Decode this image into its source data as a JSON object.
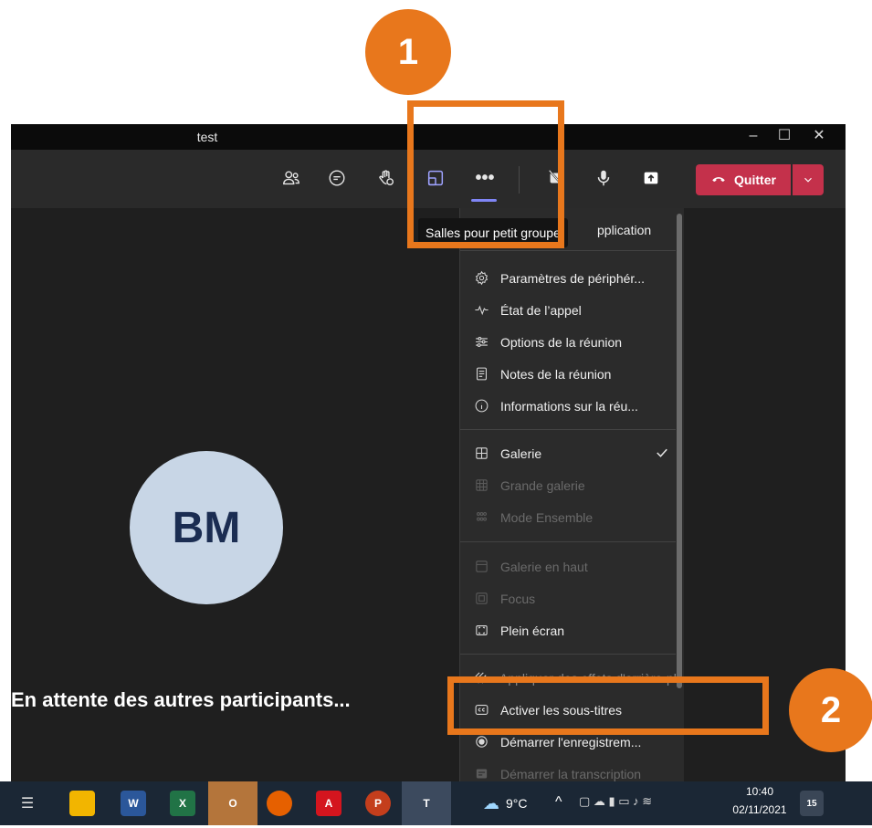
{
  "window": {
    "title": "test",
    "controls": {
      "minimize": "–",
      "maximize": "☐",
      "close": "✕"
    }
  },
  "toolbar": {
    "icons": [
      "participants-icon",
      "chat-icon",
      "raise-hand-icon",
      "breakout-rooms-icon",
      "more-actions-icon",
      "camera-off-icon",
      "mic-icon",
      "share-icon"
    ],
    "quit_label": "Quitter"
  },
  "tooltip": "Salles pour petit groupe",
  "menu": {
    "partial_top_item": "pplication",
    "items": [
      {
        "label": "Paramètres de périphér...",
        "icon": "gear-icon",
        "disabled": false
      },
      {
        "label": "État de l’appel",
        "icon": "pulse-icon",
        "disabled": false
      },
      {
        "label": "Options de la réunion",
        "icon": "sliders-icon",
        "disabled": false
      },
      {
        "label": "Notes de la réunion",
        "icon": "notes-icon",
        "disabled": false
      },
      {
        "label": "Informations sur la réu...",
        "icon": "info-icon",
        "disabled": false
      },
      {
        "label": "Galerie",
        "icon": "grid-icon",
        "disabled": false,
        "checked": true
      },
      {
        "label": "Grande galerie",
        "icon": "large-grid-icon",
        "disabled": true
      },
      {
        "label": "Mode Ensemble",
        "icon": "together-icon",
        "disabled": true
      },
      {
        "label": "Galerie en haut",
        "icon": "gallery-top-icon",
        "disabled": true
      },
      {
        "label": "Focus",
        "icon": "focus-icon",
        "disabled": true
      },
      {
        "label": "Plein écran",
        "icon": "fullscreen-icon",
        "disabled": false
      },
      {
        "label": "Appliquer des effets d'arrière-plan",
        "icon": "background-effects-icon",
        "disabled": false,
        "partial": true
      },
      {
        "label": "Activer les sous-titres",
        "icon": "captions-icon",
        "disabled": false
      },
      {
        "label": "Démarrer l'enregistrem...",
        "icon": "record-icon",
        "disabled": false,
        "partial": true
      },
      {
        "label": "Démarrer la transcription",
        "icon": "transcript-icon",
        "disabled": true
      }
    ]
  },
  "stage": {
    "avatar_initials": "BM",
    "waiting_text": "En attente des autres participants..."
  },
  "annotations": {
    "step1": "1",
    "step2": "2"
  },
  "taskbar": {
    "apps": [
      "task-view-icon",
      "file-explorer-icon",
      "word-icon",
      "excel-icon",
      "outlook-icon",
      "firefox-icon",
      "acrobat-icon",
      "powerpoint-icon",
      "teams-icon"
    ],
    "weather": "9°C",
    "time": "10:40",
    "date": "02/11/2021",
    "notifications": "15"
  },
  "colors": {
    "accent": "#e8771c",
    "quit": "#c4314b",
    "teams_purple": "#7f85f5"
  }
}
